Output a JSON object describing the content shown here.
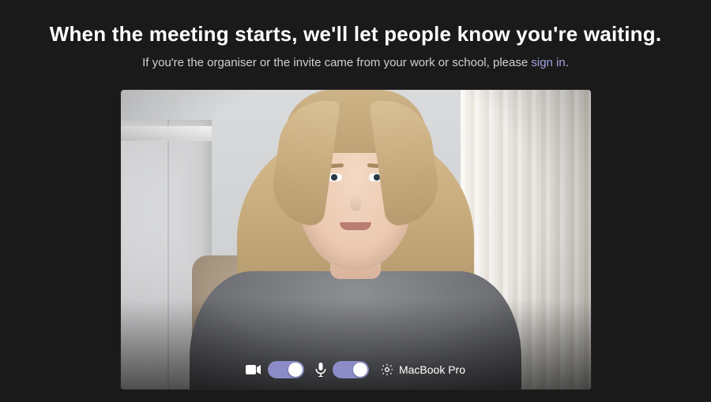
{
  "header": {
    "headline": "When the meeting starts, we'll let people know you're waiting.",
    "subline_prefix": "If you're the organiser or the invite came from your work or school, please ",
    "sign_in_label": "sign in",
    "subline_suffix": "."
  },
  "controls": {
    "camera": {
      "on": true
    },
    "mic": {
      "on": true
    },
    "device_label": "MacBook Pro"
  }
}
